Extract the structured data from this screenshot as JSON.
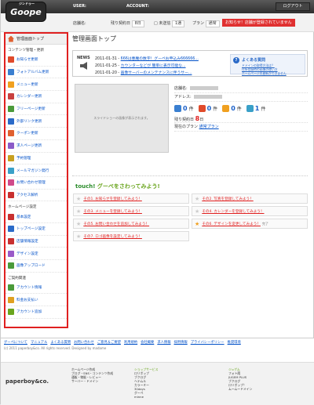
{
  "header": {
    "logo": "Goope",
    "logo_small": "ジンドゥー",
    "user_label": "USER:",
    "account_label": "ACCOUNT:",
    "logout": "ログアウト"
  },
  "status": {
    "store_label": "店舗名:",
    "days_label": "残り契約日",
    "days_box": "8日",
    "unread_label": "未送信",
    "count_box": "1通",
    "plan_label": "プラン",
    "plan_box": "通常",
    "alert": "お知らせ！店舗が登録されていません"
  },
  "sidebar": {
    "top": "管理画面トップ",
    "sections": [
      {
        "title": "コンテンツ管理・更新",
        "items": [
          {
            "label": "お知らせ更新",
            "color": "#e04a2a"
          },
          {
            "label": "フォトアルバム更新",
            "color": "#3a7fd0"
          },
          {
            "label": "メニュー更新",
            "color": "#f0a020"
          },
          {
            "label": "カレンダー更新",
            "color": "#c84040"
          },
          {
            "label": "フリーページ更新",
            "color": "#4a9a3a"
          },
          {
            "label": "外部リンク更新",
            "color": "#2a6ac8"
          },
          {
            "label": "クーポン更新",
            "color": "#e06030"
          },
          {
            "label": "求人ページ更新",
            "color": "#8a5ac8"
          },
          {
            "label": "予約管理",
            "color": "#c8a020"
          },
          {
            "label": "メールマガジン発行",
            "color": "#3aa0c8"
          },
          {
            "label": "お問い合わせ管理",
            "color": "#d04a8a"
          },
          {
            "label": "アクセス解析",
            "color": "#c83030"
          }
        ]
      },
      {
        "title": "ホームページ設定",
        "items": [
          {
            "label": "基本設定",
            "color": "#c83030"
          },
          {
            "label": "トップページ設定",
            "color": "#2a6ac8"
          },
          {
            "label": "店舗情報設定",
            "color": "#c83030"
          },
          {
            "label": "デザイン設定",
            "color": "#9a5ac8"
          },
          {
            "label": "画像アップロード",
            "color": "#4a9a3a"
          }
        ]
      },
      {
        "title": "ご契約関連",
        "items": [
          {
            "label": "アカウント情報",
            "color": "#4a9a3a"
          },
          {
            "label": "料金お支払い",
            "color": "#e0a020"
          },
          {
            "label": "アカウント追加",
            "color": "#6aa51e"
          }
        ]
      }
    ]
  },
  "main": {
    "title": "管理画面トップ",
    "news_label": "NEWS",
    "news": [
      {
        "date": "2011-01-31 -",
        "text": "666は悪魔の数字！グーペお申込み666666..."
      },
      {
        "date": "2011-01-25 -",
        "text": "カウンターなどが 簡単に表示可能な..."
      },
      {
        "date": "2011-01-20 -",
        "text": "画像サーバーのメンテナンスに伴うサー..."
      }
    ],
    "faq_title": "よくある質問",
    "faq_links": [
      "ドメインの取得方法は？",
      "住所登録時の画像の使い方",
      "ホームページの更新ができません"
    ],
    "slideshow": "スライドショーの画像が表示されます。",
    "store_label": "店舗名:",
    "address_label": "アドレス:",
    "counts": [
      {
        "n": "0",
        "unit": "件",
        "color": "#3a7fd0"
      },
      {
        "n": "0",
        "unit": "件",
        "color": "#e04a2a"
      },
      {
        "n": "0",
        "unit": "件",
        "color": "#f0a020"
      },
      {
        "n": "1",
        "unit": "件",
        "color": "#3aa0c8"
      }
    ],
    "days_label": "残り契約日",
    "days_value": "8",
    "days_unit": "日",
    "plan_label": "現在のプラン",
    "plan_link": "通常プラン",
    "touch_prefix": "touch!",
    "touch_title": " グーペをさわってみよう!",
    "touch_cards": [
      {
        "text": "その1. お知らせを登録してみよう！",
        "gold": false,
        "done": ""
      },
      {
        "text": "その2. 写真を登録してみよう！",
        "gold": false,
        "done": ""
      },
      {
        "text": "その3. メニューを登録してみよう！",
        "gold": false,
        "done": ""
      },
      {
        "text": "その4. カレンダーを登録してみよう！",
        "gold": false,
        "done": ""
      },
      {
        "text": "その5. お問い合わせを追加してみよう！",
        "gold": false,
        "done": ""
      },
      {
        "text": "その6. デザインを変更してみよう！",
        "gold": true,
        "done": "完了"
      },
      {
        "text": "その7. ロゴ画像を設定してみよう！",
        "gold": false,
        "done": ""
      }
    ]
  },
  "footer": {
    "links": [
      "グーペについて",
      "マニュアル",
      "よくある質問",
      "お問い合わせ",
      "ご意見＆ご要望",
      "利用規約",
      "会社概要",
      "求人情報",
      "採用情報",
      "プライバシーポリシー",
      "推奨環境"
    ],
    "copyright": "(c) 2011 paperboy&co. All rights reserved. Designed by madame",
    "brand": "paperboy&co.",
    "col1": [
      "ホームページ作成",
      "ブログ・SNS・コンテンツ作成",
      "通販・物販・レビュー",
      "サーバー・ドメイン"
    ],
    "col2": [
      "ショップサービス",
      "ロリポップ",
      "ブクログ",
      "ヘテムル",
      "カラーミー",
      "30days",
      "グーペ",
      "minne"
    ],
    "col3": [
      "ジュゲム",
      "フォト蔵",
      "JUGEM PLUS",
      "ブクログ",
      "ロリポップ！",
      "ムームードメイン"
    ]
  }
}
